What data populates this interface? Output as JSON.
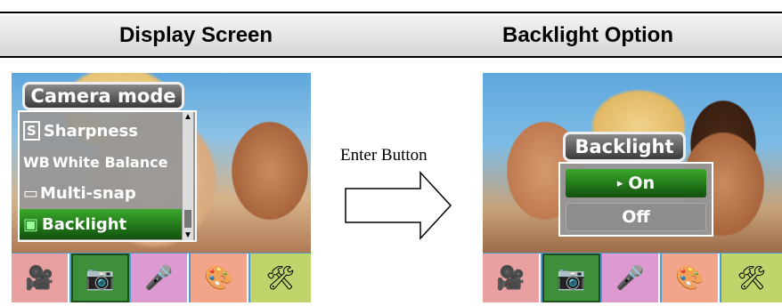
{
  "columns": {
    "left_title": "Display Screen",
    "right_title": "Backlight Option"
  },
  "arrow_label": "Enter Button",
  "left_screen": {
    "menu_title": "Camera mode",
    "items": [
      {
        "icon": "S",
        "label": "Sharpness",
        "selected": false
      },
      {
        "icon": "WB",
        "label": "White Balance",
        "selected": false
      },
      {
        "icon": "▭",
        "label": "Multi-snap",
        "selected": false
      },
      {
        "icon": "▣",
        "label": "Backlight",
        "selected": true
      }
    ]
  },
  "right_screen": {
    "popup_title": "Backlight",
    "options": [
      {
        "label": "On",
        "marker": "▸",
        "selected": true
      },
      {
        "label": "Off",
        "marker": "",
        "selected": false
      }
    ]
  },
  "mode_icons": [
    {
      "name": "video-camera-icon",
      "glyph": "🎥",
      "color": "#e58b8b"
    },
    {
      "name": "still-camera-icon",
      "glyph": "📷",
      "color": "#3d8f3a"
    },
    {
      "name": "microphone-icon",
      "glyph": "🎤",
      "color": "#d98bc9"
    },
    {
      "name": "palette-icon",
      "glyph": "🎨",
      "color": "#ef9a7e"
    },
    {
      "name": "tools-icon",
      "glyph": "🛠",
      "color": "#b6cc5a"
    }
  ],
  "colors": {
    "selected_green": "#2a8a22",
    "menu_gray": "#969696"
  }
}
